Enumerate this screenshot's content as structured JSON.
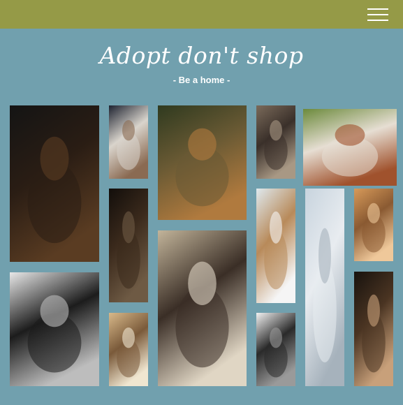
{
  "theme": {
    "background": "#71a0ae",
    "navbar": "#959a47",
    "text": "#ffffff"
  },
  "navbar": {
    "menu_icon": "hamburger-menu-icon"
  },
  "hero": {
    "title": "Adopt don't shop",
    "subtitle": "- Be a home -"
  },
  "gallery": [
    {
      "name": "photo-german-shepherd",
      "subject": "german shepherd dog",
      "palette": [
        "#141414",
        "#2a1d14",
        "#5a3c22"
      ]
    },
    {
      "name": "photo-ragdoll-cat",
      "subject": "ragdoll cat",
      "palette": [
        "#1d2230",
        "#d9d4cc",
        "#8a6a52"
      ]
    },
    {
      "name": "photo-airedale-terrier",
      "subject": "airedale terrier on grass",
      "palette": [
        "#2f3a1f",
        "#6a5a34",
        "#b07a3e"
      ]
    },
    {
      "name": "photo-shaggy-dog",
      "subject": "shaggy dog portrait",
      "palette": [
        "#7a6a5a",
        "#3a302a",
        "#a89884"
      ]
    },
    {
      "name": "photo-sleeping-puppy",
      "subject": "puppy lying on grass with toy",
      "palette": [
        "#6c8a3c",
        "#e6ded3",
        "#a0522d"
      ]
    },
    {
      "name": "photo-dark-dog-portrait",
      "subject": "dark dog portrait",
      "palette": [
        "#120e0b",
        "#3b2a1c",
        "#6e5a44"
      ]
    },
    {
      "name": "photo-tabby-cat",
      "subject": "tabby cat sitting",
      "palette": [
        "#dfe9ee",
        "#b88a5a",
        "#f5f5f5"
      ]
    },
    {
      "name": "photo-window-cat",
      "subject": "cat behind window",
      "palette": [
        "#c8d4de",
        "#e8ecf0",
        "#a6b2bc"
      ]
    },
    {
      "name": "photo-yorkie",
      "subject": "yorkshire terrier",
      "palette": [
        "#d79a5a",
        "#8a5a32",
        "#efc89a"
      ]
    },
    {
      "name": "photo-siamese-cat",
      "subject": "siamese cat walking",
      "palette": [
        "#c2b49a",
        "#3a2e26",
        "#e0d6c4"
      ]
    },
    {
      "name": "photo-boston-terrier",
      "subject": "boston terrier on bed",
      "palette": [
        "#e8e8e8",
        "#1c1c1c",
        "#bdbdbd"
      ]
    },
    {
      "name": "photo-cat-tree",
      "subject": "kitten on scratching post",
      "palette": [
        "#d8b98a",
        "#7a5a3a",
        "#f0e6d0"
      ]
    },
    {
      "name": "photo-kitten",
      "subject": "tuxedo kitten",
      "palette": [
        "#f2f2f2",
        "#2a2a2a",
        "#9a9a9a"
      ]
    },
    {
      "name": "photo-dog-at-window",
      "subject": "dog peeking through window",
      "palette": [
        "#17120e",
        "#4a3422",
        "#c8a07a"
      ]
    }
  ]
}
